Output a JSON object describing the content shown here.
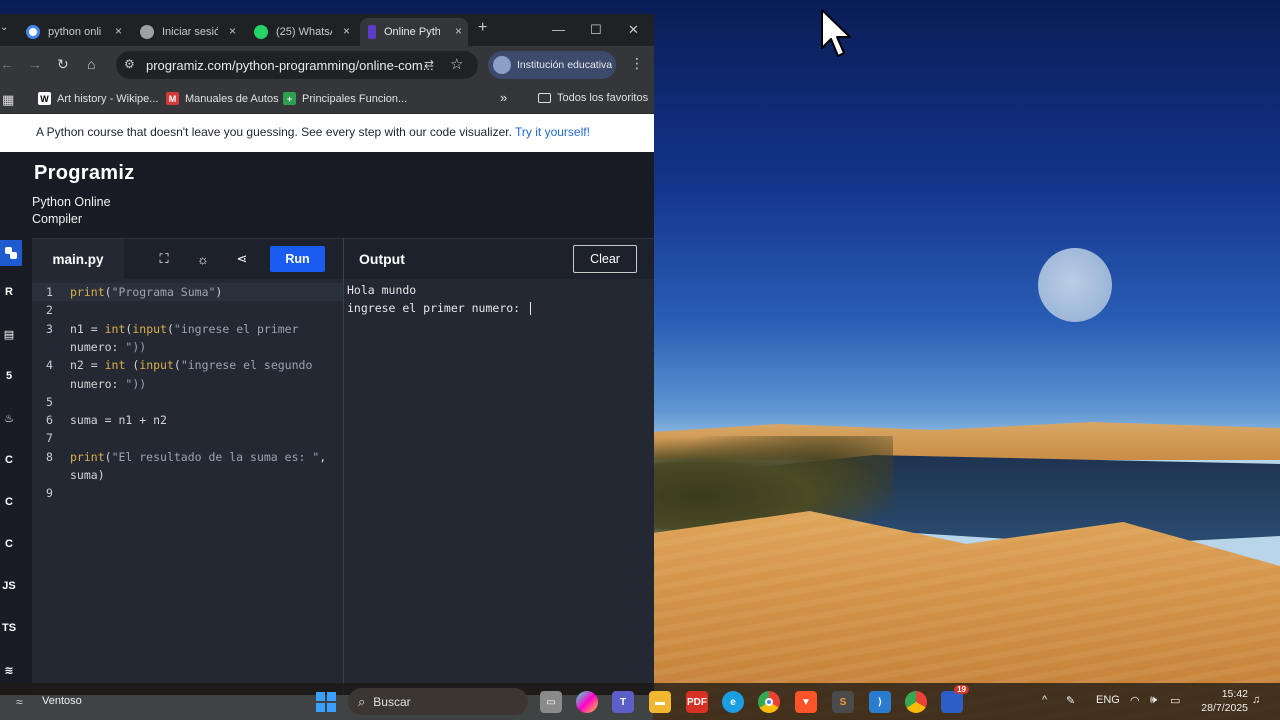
{
  "browser": {
    "tabs": [
      {
        "label": "python onli",
        "icon": "google-icon",
        "color": "#4285f4",
        "active": false
      },
      {
        "label": "Iniciar sesió",
        "icon": "globe-icon",
        "color": "#9aa0a6",
        "active": false
      },
      {
        "label": "(25) WhatsA",
        "icon": "whatsapp-icon",
        "color": "#25d366",
        "active": false
      },
      {
        "label": "Online Pyth",
        "icon": "programiz-icon",
        "color": "#5b3cc4",
        "active": true
      }
    ],
    "new_tab": "+",
    "close_glyph": "×",
    "window_controls": {
      "minimize": "—",
      "maximize": "☐",
      "close": "✕"
    },
    "url": "programiz.com/python-programming/online-com...",
    "profile_label": "Institución educativa",
    "bookmarks": [
      {
        "label": "Art history - Wikipe...",
        "icon": "wikipedia-icon",
        "glyph": "W",
        "color": "#e8e8e8"
      },
      {
        "label": "Manuales de Autos",
        "icon": "manuales-icon",
        "glyph": "M",
        "color": "#d33b3b"
      },
      {
        "label": "Principales Funcion...",
        "icon": "sheets-icon",
        "glyph": "+",
        "color": "#2e9e4f"
      }
    ],
    "bookmarks_overflow": "»",
    "all_bookmarks": "Todos los favoritos"
  },
  "page": {
    "banner_text": "A Python course that doesn't leave you guessing. See every step with our code visualizer.",
    "banner_link": "Try it yourself!",
    "logo": "Programiz",
    "subtitle": "Python Online Compiler",
    "languages": [
      "python-icon",
      "r-icon",
      "sql-icon",
      "html5-icon",
      "java-icon",
      "c-icon",
      "cpp-icon",
      "csharp-icon",
      "JS",
      "TS",
      "swift-icon"
    ],
    "editor": {
      "filename": "main.py",
      "run_label": "Run",
      "lines": [
        {
          "n": "1",
          "text": "print(\"Programa Suma\")",
          "highlight": true
        },
        {
          "n": "2",
          "text": ""
        },
        {
          "n": "3",
          "text": "n1 = int(input(\"ingrese el primer"
        },
        {
          "n": "",
          "text": "    numero: \"))"
        },
        {
          "n": "4",
          "text": "n2 = int (input(\"ingrese el segundo"
        },
        {
          "n": "",
          "text": "    numero: \"))"
        },
        {
          "n": "5",
          "text": ""
        },
        {
          "n": "6",
          "text": "suma = n1 + n2"
        },
        {
          "n": "7",
          "text": ""
        },
        {
          "n": "8",
          "text": "print(\"El resultado de la suma es: \","
        },
        {
          "n": "",
          "text": "    suma)"
        },
        {
          "n": "9",
          "text": ""
        }
      ]
    },
    "output": {
      "title": "Output",
      "clear_label": "Clear",
      "lines": [
        "Hola mundo",
        "ingrese el primer numero: "
      ]
    }
  },
  "taskbar": {
    "weather": "Ventoso",
    "search_label": "Buscar",
    "apps": [
      "file-explorer-icon",
      "copilot-icon",
      "teams-icon",
      "folder-icon",
      "pdf-icon",
      "edge-icon",
      "chrome-icon",
      "brave-icon",
      "sublime-icon",
      "vscode-icon",
      "chrome-profile-icon",
      "zoom-icon"
    ],
    "zoom_badge": "19",
    "tray": {
      "chevron": "^",
      "language": "ENG",
      "wifi": "wifi-icon",
      "volume": "volume-icon",
      "battery": "battery-icon"
    },
    "time": "15:42",
    "date": "28/7/2025"
  }
}
